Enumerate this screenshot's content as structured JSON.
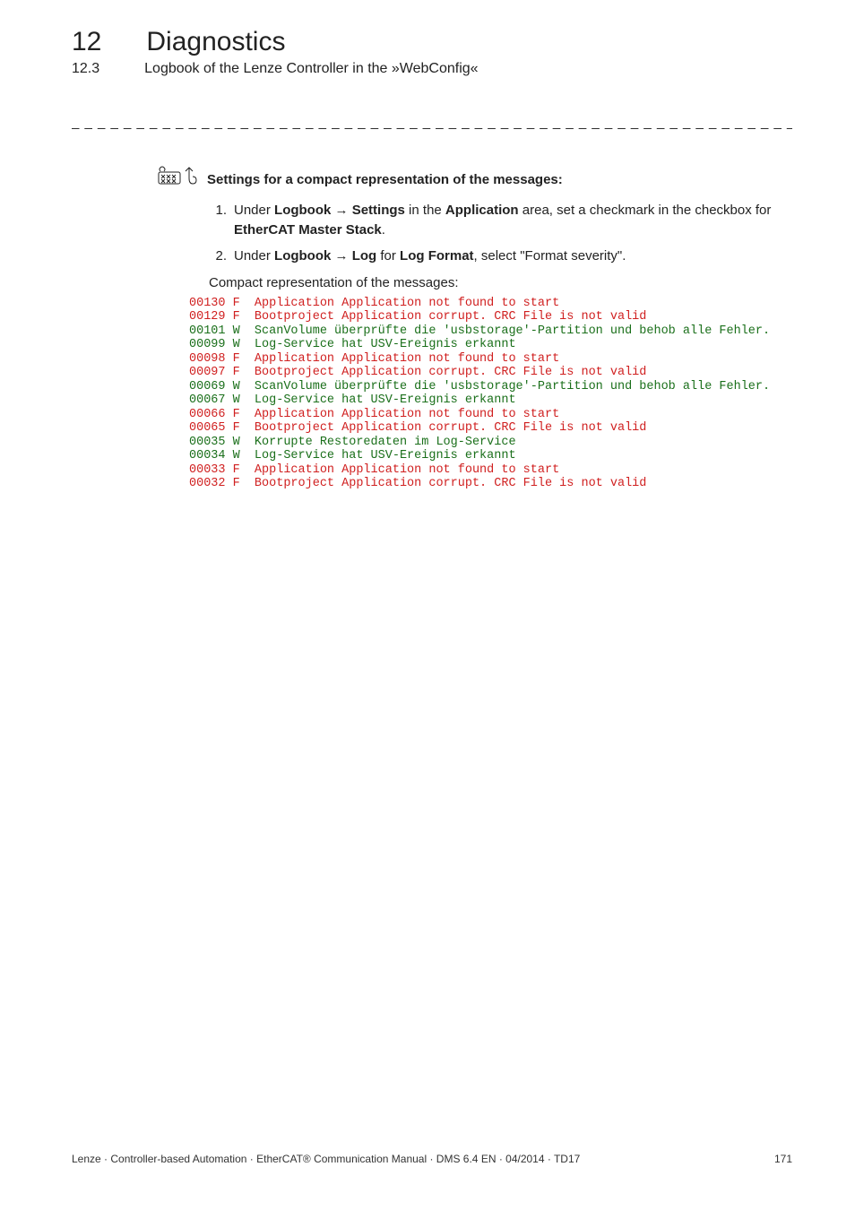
{
  "header": {
    "chapter_number": "12",
    "chapter_title": "Diagnostics",
    "subsection_number": "12.3",
    "subsection_title": "Logbook of the Lenze Controller in the »WebConfig«"
  },
  "howto": {
    "title": "Settings for a compact representation of the messages:",
    "step1": {
      "num": "1.",
      "pre": "Under ",
      "b1": "Logbook",
      "arrow1": " → ",
      "b2": "Settings",
      "mid": " in the ",
      "b3": "Application",
      "post": " area, set a checkmark in the checkbox for ",
      "b4": "EtherCAT Master Stack",
      "tail": "."
    },
    "step2": {
      "num": "2.",
      "pre": "Under ",
      "b1": "Logbook",
      "arrow1": " → ",
      "b2": "Log",
      "mid": " for ",
      "b3": "Log Format",
      "post": ", select \"Format severity\"."
    },
    "compact_caption": "Compact representation of the messages:"
  },
  "log": [
    {
      "id": "00130",
      "sev": "F",
      "msg": "Application Application not found to start"
    },
    {
      "id": "00129",
      "sev": "F",
      "msg": "Bootproject Application corrupt. CRC File is not valid"
    },
    {
      "id": "00101",
      "sev": "W",
      "msg": "ScanVolume überprüfte die 'usbstorage'-Partition und behob alle Fehler."
    },
    {
      "id": "00099",
      "sev": "W",
      "msg": "Log-Service hat USV-Ereignis erkannt"
    },
    {
      "id": "00098",
      "sev": "F",
      "msg": "Application Application not found to start"
    },
    {
      "id": "00097",
      "sev": "F",
      "msg": "Bootproject Application corrupt. CRC File is not valid"
    },
    {
      "id": "00069",
      "sev": "W",
      "msg": "ScanVolume überprüfte die 'usbstorage'-Partition und behob alle Fehler."
    },
    {
      "id": "00067",
      "sev": "W",
      "msg": "Log-Service hat USV-Ereignis erkannt"
    },
    {
      "id": "00066",
      "sev": "F",
      "msg": "Application Application not found to start"
    },
    {
      "id": "00065",
      "sev": "F",
      "msg": "Bootproject Application corrupt. CRC File is not valid"
    },
    {
      "id": "00035",
      "sev": "W",
      "msg": "Korrupte Restoredaten im Log-Service"
    },
    {
      "id": "00034",
      "sev": "W",
      "msg": "Log-Service hat USV-Ereignis erkannt"
    },
    {
      "id": "00033",
      "sev": "F",
      "msg": "Application Application not found to start"
    },
    {
      "id": "00032",
      "sev": "F",
      "msg": "Bootproject Application corrupt. CRC File is not valid"
    }
  ],
  "footer": {
    "left": "Lenze · Controller-based Automation · EtherCAT® Communication Manual · DMS 6.4 EN · 04/2014 · TD17",
    "right": "171"
  }
}
